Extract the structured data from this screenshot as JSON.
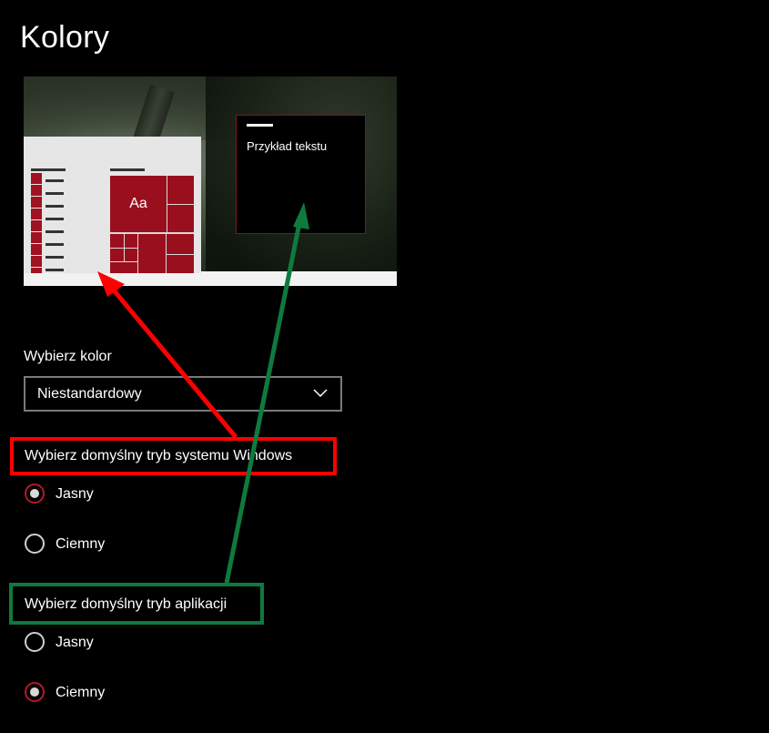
{
  "page": {
    "title": "Kolory"
  },
  "preview": {
    "tile_text": "Aa",
    "sample_window_text": "Przykład tekstu",
    "accent_color": "#9a0f1d"
  },
  "color_select": {
    "label": "Wybierz kolor",
    "value": "Niestandardowy"
  },
  "windows_mode": {
    "heading": "Wybierz domyślny tryb systemu Windows",
    "options": [
      {
        "label": "Jasny",
        "checked": true
      },
      {
        "label": "Ciemny",
        "checked": false
      }
    ]
  },
  "app_mode": {
    "heading": "Wybierz domyślny tryb aplikacji",
    "options": [
      {
        "label": "Jasny",
        "checked": false
      },
      {
        "label": "Ciemny",
        "checked": true
      }
    ]
  },
  "annotations": {
    "red_color": "#ff0000",
    "green_color": "#0e7a3d"
  }
}
